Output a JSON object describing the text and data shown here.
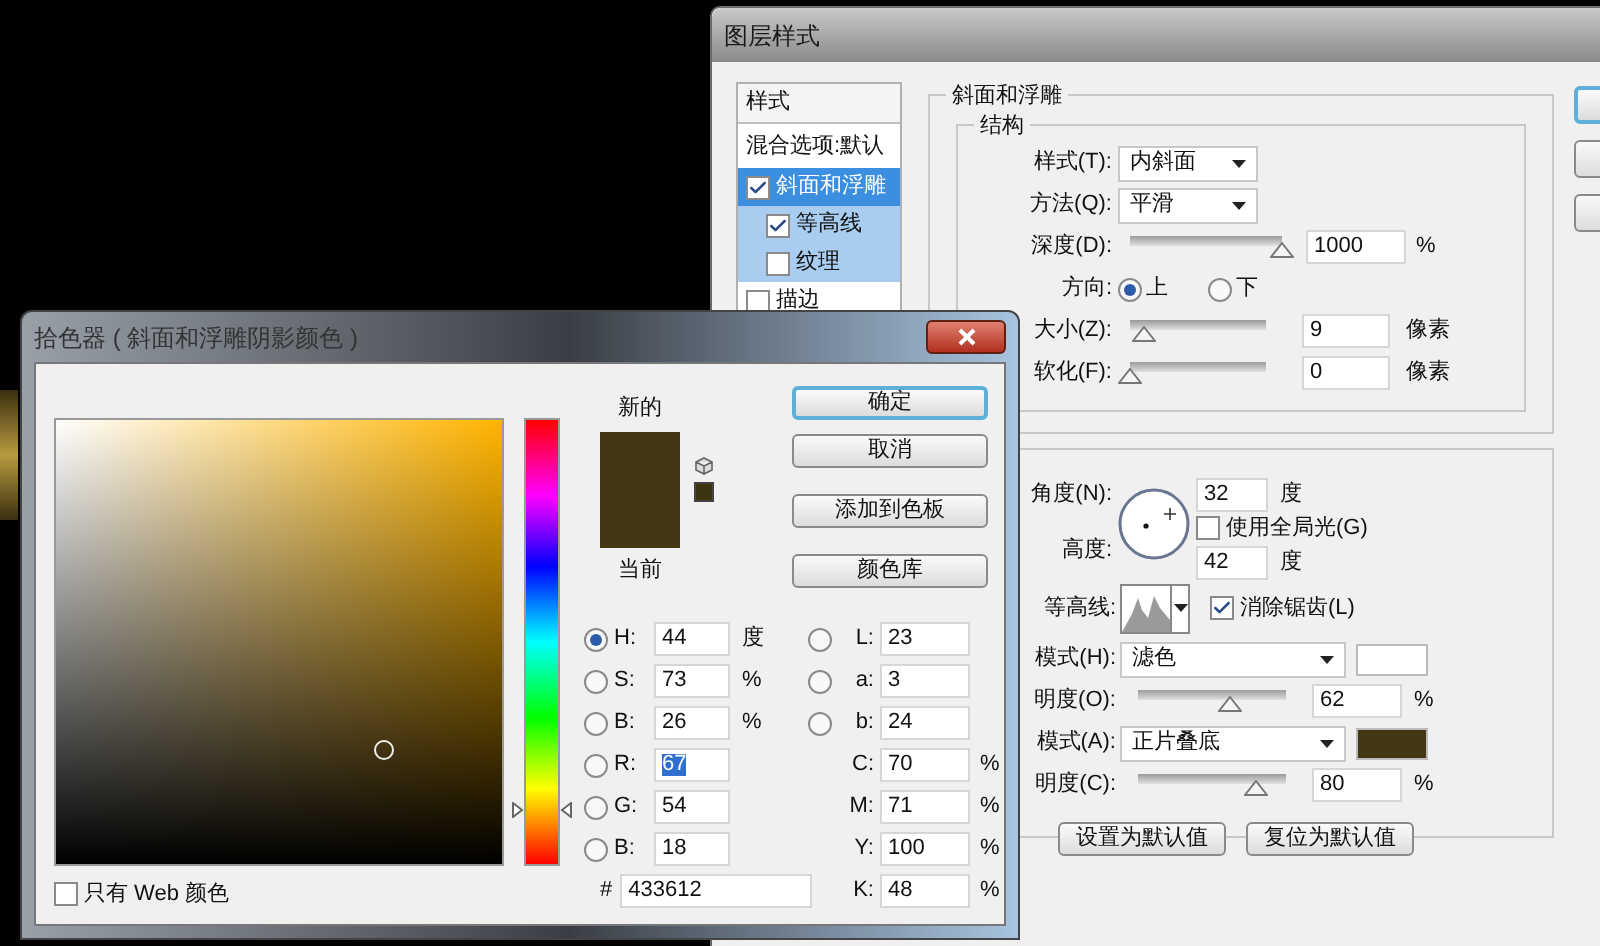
{
  "layer_style_window": {
    "title": "图层样式",
    "style_list": [
      {
        "label": "样式",
        "kind": "header"
      },
      {
        "label": "混合选项:默认",
        "kind": "plain"
      },
      {
        "label": "斜面和浮雕",
        "kind": "check",
        "checked": true,
        "selected": true,
        "children": [
          {
            "label": "等高线",
            "checked": true,
            "selected": false
          },
          {
            "label": "纹理",
            "checked": false,
            "selected": false
          }
        ]
      },
      {
        "label": "描边",
        "kind": "check",
        "checked": false,
        "selected": false
      }
    ],
    "bevel": {
      "title": "斜面和浮雕",
      "structure_title": "结构",
      "style": {
        "label": "样式(T):",
        "value": "内斜面"
      },
      "technique": {
        "label": "方法(Q):",
        "value": "平滑"
      },
      "depth": {
        "label": "深度(D):",
        "level": 1,
        "value": "1000",
        "unit": "%"
      },
      "direction": {
        "label": "方向:",
        "options": [
          {
            "label": "上",
            "selected": true
          },
          {
            "label": "下",
            "selected": false
          }
        ]
      },
      "size": {
        "label": "大小(Z):",
        "level": 0.1,
        "value": "9",
        "unit": "像素"
      },
      "soften": {
        "label": "软化(F):",
        "level": 0,
        "value": "0",
        "unit": "像素"
      }
    },
    "shading": {
      "angle": {
        "label": "角度(N):",
        "value": "32",
        "unit": "度"
      },
      "global_light": {
        "label": "使用全局光(G)",
        "checked": false
      },
      "altitude": {
        "label": "高度:",
        "value": "42",
        "unit": "度"
      },
      "contour": {
        "label": "等高线:"
      },
      "anti_alias": {
        "label": "消除锯齿(L)",
        "checked": true
      },
      "highlight_mode": {
        "label": "模式(H):",
        "value": "滤色",
        "color": "#ffffff"
      },
      "highlight_opacity": {
        "label": "明度(O):",
        "level": 0.62,
        "value": "62",
        "unit": "%"
      },
      "shadow_mode": {
        "label": "模式(A):",
        "value": "正片叠底",
        "color": "#433612"
      },
      "shadow_opacity": {
        "label": "明度(C):",
        "level": 0.8,
        "value": "80",
        "unit": "%"
      }
    },
    "buttons": [
      "设置为默认值",
      "复位为默认值"
    ],
    "side_buttons": [
      {
        "focused": true
      },
      {
        "focused": false
      },
      {
        "focused": false
      }
    ]
  },
  "color_picker": {
    "title": "拾色器 ( 斜面和浮雕阴影颜色 )",
    "new_swatch": {
      "label": "新的",
      "color": "#433612"
    },
    "current_swatch": {
      "label": "当前",
      "color": "#433612"
    },
    "buttons": [
      {
        "label": "确定",
        "focused": true
      },
      {
        "label": "取消",
        "focused": false
      },
      {
        "label": "添加到色板",
        "focused": false
      },
      {
        "label": "颜色库",
        "focused": false
      }
    ],
    "left_fields": [
      {
        "kind": "radio",
        "label": "H:",
        "value": "44",
        "unit": "度",
        "selected": true,
        "highlighted": false
      },
      {
        "kind": "radio",
        "label": "S:",
        "value": "73",
        "unit": "%",
        "selected": false,
        "highlighted": false
      },
      {
        "kind": "radio",
        "label": "B:",
        "value": "26",
        "unit": "%",
        "selected": false,
        "highlighted": false
      },
      {
        "kind": "radio",
        "label": "R:",
        "value": "67",
        "selected": false,
        "highlighted": true
      },
      {
        "kind": "radio",
        "label": "G:",
        "value": "54",
        "selected": false,
        "highlighted": false
      },
      {
        "kind": "radio",
        "label": "B:",
        "value": "18",
        "selected": false,
        "highlighted": false
      }
    ],
    "right_fields": [
      {
        "kind": "radio",
        "label": "L:",
        "value": "23",
        "selected": false,
        "highlighted": false
      },
      {
        "kind": "radio",
        "label": "a:",
        "value": "3",
        "selected": false,
        "highlighted": false
      },
      {
        "kind": "radio",
        "label": "b:",
        "value": "24",
        "selected": false,
        "highlighted": false
      },
      {
        "kind": "plain",
        "label": "C:",
        "value": "70",
        "unit": "%",
        "highlighted": false
      },
      {
        "kind": "plain",
        "label": "M:",
        "value": "71",
        "unit": "%",
        "highlighted": false
      },
      {
        "kind": "plain",
        "label": "Y:",
        "value": "100",
        "unit": "%",
        "highlighted": false
      },
      {
        "kind": "plain",
        "label": "K:",
        "value": "48",
        "unit": "%",
        "highlighted": false
      }
    ],
    "hex": {
      "label": "#",
      "value": "433612"
    },
    "web_only": {
      "label": "只有 Web 颜色",
      "checked": false
    }
  }
}
